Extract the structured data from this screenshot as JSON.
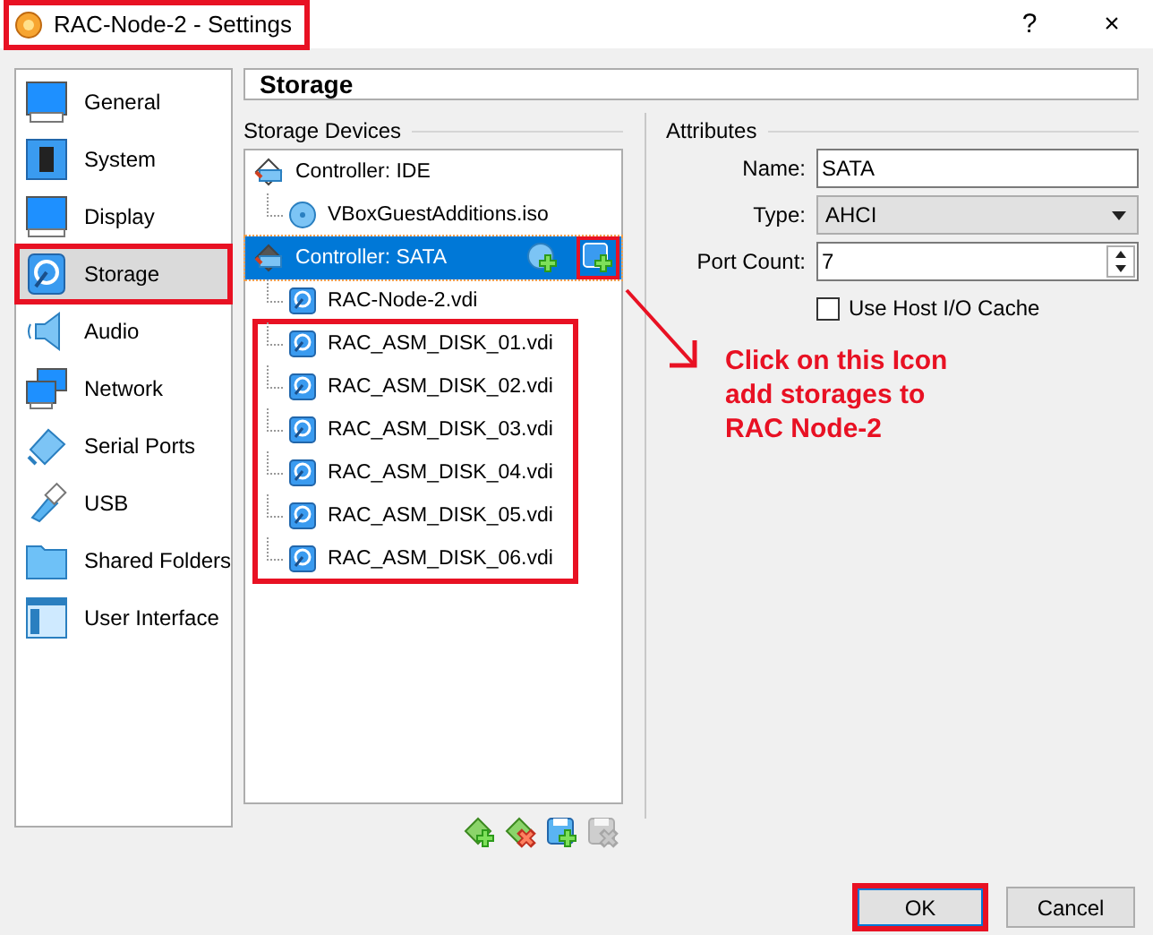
{
  "window": {
    "title": "RAC-Node-2 - Settings",
    "highlighted": true,
    "help": "?",
    "close": "×"
  },
  "sidebar": {
    "items": [
      {
        "label": "General",
        "kind": "general",
        "selected": false,
        "highlighted": false
      },
      {
        "label": "System",
        "kind": "system",
        "selected": false,
        "highlighted": false
      },
      {
        "label": "Display",
        "kind": "display",
        "selected": false,
        "highlighted": false
      },
      {
        "label": "Storage",
        "kind": "storage",
        "selected": true,
        "highlighted": true
      },
      {
        "label": "Audio",
        "kind": "audio",
        "selected": false,
        "highlighted": false
      },
      {
        "label": "Network",
        "kind": "network",
        "selected": false,
        "highlighted": false
      },
      {
        "label": "Serial Ports",
        "kind": "serial",
        "selected": false,
        "highlighted": false
      },
      {
        "label": "USB",
        "kind": "usb",
        "selected": false,
        "highlighted": false
      },
      {
        "label": "Shared Folders",
        "kind": "folder",
        "selected": false,
        "highlighted": false
      },
      {
        "label": "User Interface",
        "kind": "ui",
        "selected": false,
        "highlighted": false
      }
    ]
  },
  "page_title": "Storage",
  "storage_devices": {
    "label": "Storage Devices",
    "tree": [
      {
        "label": "Controller: IDE",
        "kind": "ide",
        "selected": false,
        "children": [
          {
            "label": "VBoxGuestAdditions.iso",
            "kind": "optical",
            "selected": false,
            "highlighted": false
          }
        ]
      },
      {
        "label": "Controller: SATA",
        "kind": "sata",
        "selected": true,
        "actions": [
          {
            "kind": "add-optical",
            "highlighted": false
          },
          {
            "kind": "add-disk",
            "highlighted": true
          }
        ],
        "children": [
          {
            "label": "RAC-Node-2.vdi",
            "kind": "disk",
            "selected": false,
            "highlighted": false
          },
          {
            "label": "RAC_ASM_DISK_01.vdi",
            "kind": "disk",
            "selected": false,
            "highlighted": true
          },
          {
            "label": "RAC_ASM_DISK_02.vdi",
            "kind": "disk",
            "selected": false,
            "highlighted": true
          },
          {
            "label": "RAC_ASM_DISK_03.vdi",
            "kind": "disk",
            "selected": false,
            "highlighted": true
          },
          {
            "label": "RAC_ASM_DISK_04.vdi",
            "kind": "disk",
            "selected": false,
            "highlighted": true
          },
          {
            "label": "RAC_ASM_DISK_05.vdi",
            "kind": "disk",
            "selected": false,
            "highlighted": true
          },
          {
            "label": "RAC_ASM_DISK_06.vdi",
            "kind": "disk",
            "selected": false,
            "highlighted": true
          }
        ]
      }
    ],
    "toolbar": [
      {
        "kind": "add-controller",
        "disabled": false
      },
      {
        "kind": "remove-controller",
        "disabled": false
      },
      {
        "kind": "add-attachment",
        "disabled": false
      },
      {
        "kind": "remove-attachment",
        "disabled": true
      }
    ]
  },
  "attributes": {
    "label": "Attributes",
    "name": {
      "label": "Name:",
      "value": "SATA"
    },
    "type": {
      "label": "Type:",
      "value": "AHCI"
    },
    "port_count": {
      "label": "Port Count:",
      "value": "7"
    },
    "use_host_io_cache": {
      "label": "Use Host I/O Cache",
      "checked": false
    }
  },
  "annotation": {
    "lines": [
      "Click on this Icon",
      "add storages to",
      "RAC Node-2"
    ]
  },
  "buttons": [
    {
      "label": "OK",
      "default": true,
      "highlighted": true
    },
    {
      "label": "Cancel",
      "default": false,
      "highlighted": false
    }
  ]
}
